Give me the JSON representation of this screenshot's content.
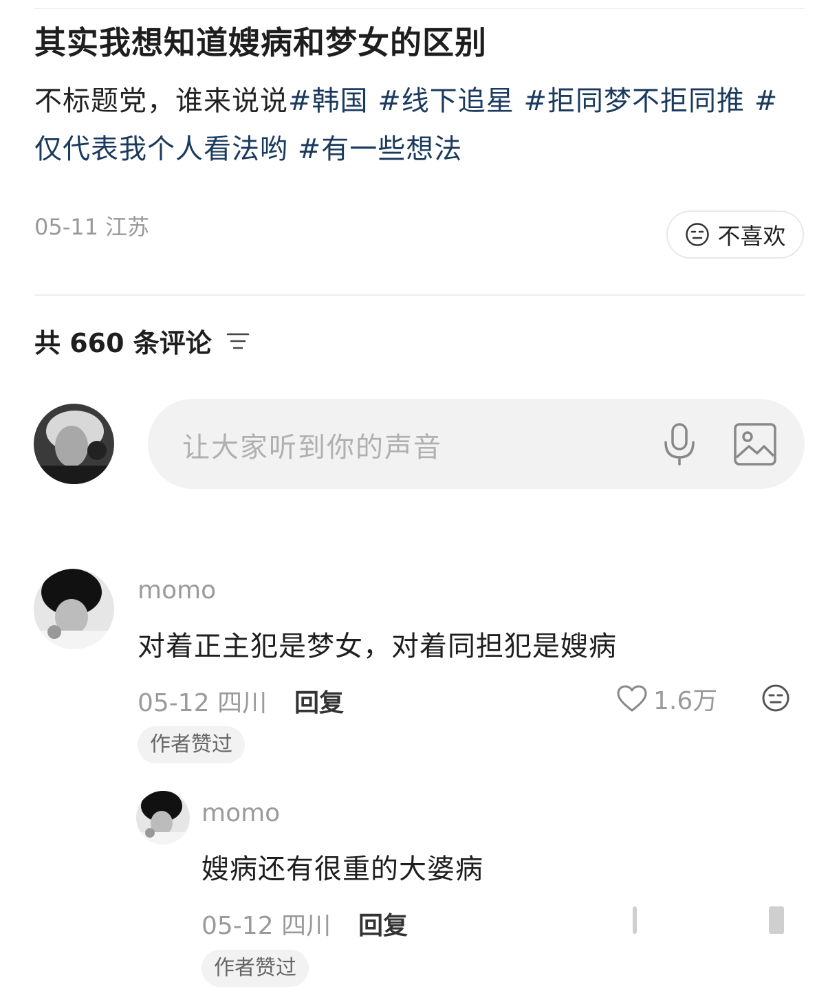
{
  "post": {
    "title": "其实我想知道嫂病和梦女的区别",
    "body_text": "不标题党，谁来说说",
    "tags": [
      "#韩国",
      "#线下追星",
      "#拒同梦不拒同推",
      "#仅代表我个人看法哟",
      "#有一些想法"
    ],
    "date": "05-11",
    "location": "江苏",
    "dislike_label": "不喜欢"
  },
  "comments_header": {
    "label": "共 660 条评论"
  },
  "composer": {
    "placeholder": "让大家听到你的声音"
  },
  "comments": [
    {
      "author": "momo",
      "text": "对着正主犯是梦女，对着同担犯是嫂病",
      "date": "05-12",
      "location": "四川",
      "reply_label": "回复",
      "likes": "1.6万",
      "badge": "作者赞过",
      "replies": [
        {
          "author": "momo",
          "text": "嫂病还有很重的大婆病",
          "date": "05-12",
          "location": "四川",
          "reply_label": "回复",
          "badge": "作者赞过"
        }
      ]
    }
  ],
  "colors": {
    "tag": "#1a3a5e",
    "muted": "#9a9a9a",
    "input_bg": "#f2f2f2"
  },
  "icons": [
    "neutral-face-icon",
    "sort-icon",
    "microphone-icon",
    "image-icon",
    "heart-icon"
  ]
}
